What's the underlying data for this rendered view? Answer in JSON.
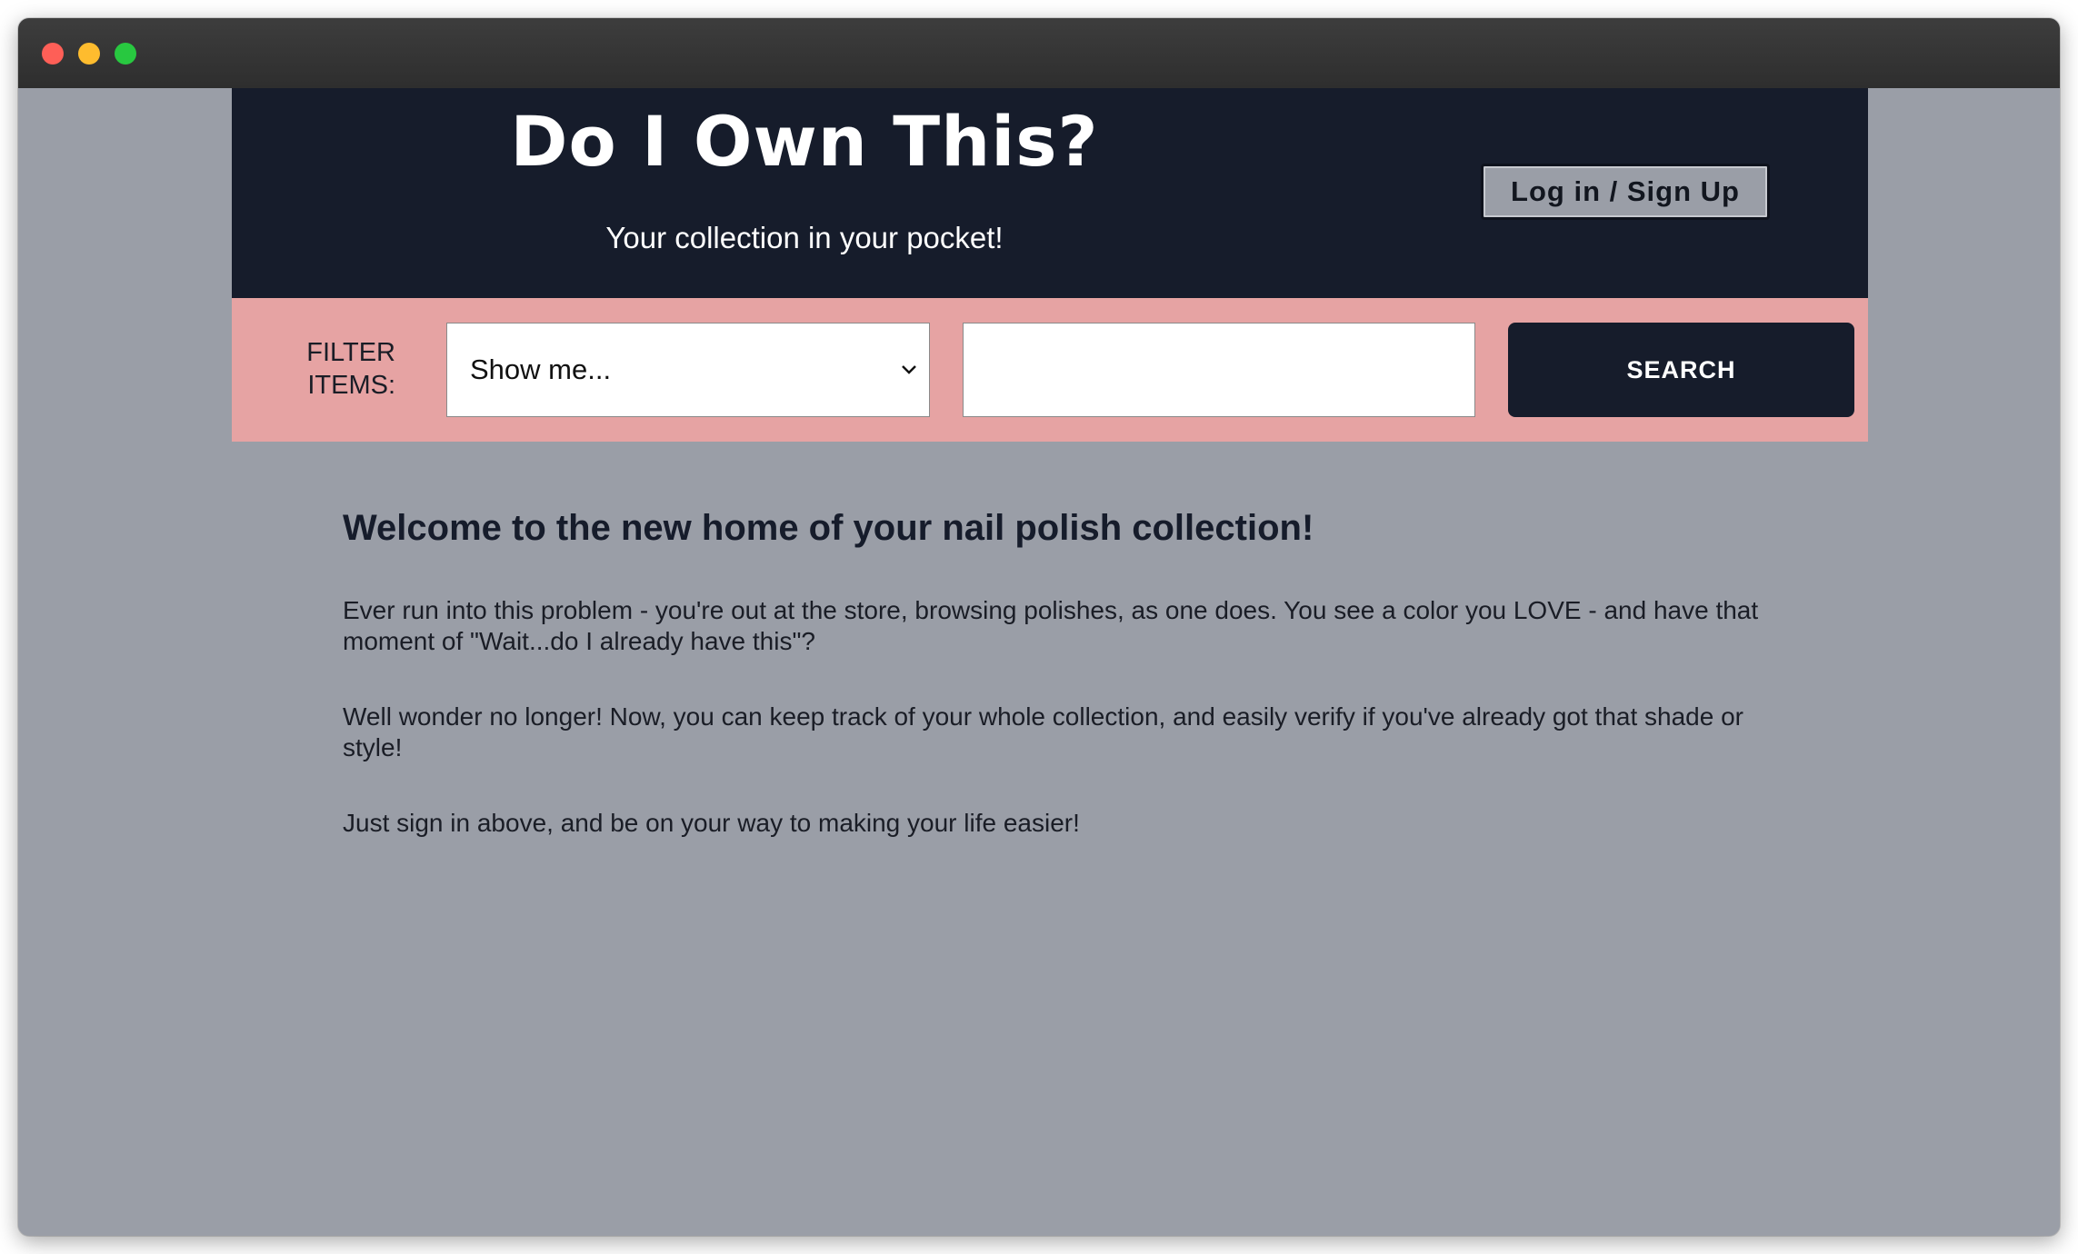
{
  "header": {
    "title": "Do I Own This?",
    "subtitle": "Your collection in your pocket!",
    "login_label": "Log in / Sign Up"
  },
  "filter": {
    "label_line1": "FILTER",
    "label_line2": "ITEMS:",
    "select_value": "Show me...",
    "search_value": "",
    "search_button_label": "SEARCH"
  },
  "main": {
    "welcome_heading": "Welcome to the new home of your nail polish collection!",
    "paragraphs": [
      "Ever run into this problem - you're out at the store, browsing polishes, as one does. You see a color you LOVE - and have that moment of \"Wait...do I already have this\"?",
      "Well wonder no longer! Now, you can keep track of your whole collection, and easily verify if you've already got that shade or style!",
      "Just sign in above, and be on your way to making your life easier!"
    ]
  },
  "colors": {
    "header_bg": "#161c2b",
    "filter_bg": "#e6a3a3",
    "page_bg": "#9a9ea7"
  },
  "icons": {
    "select_arrow": "chevron-down-icon"
  }
}
